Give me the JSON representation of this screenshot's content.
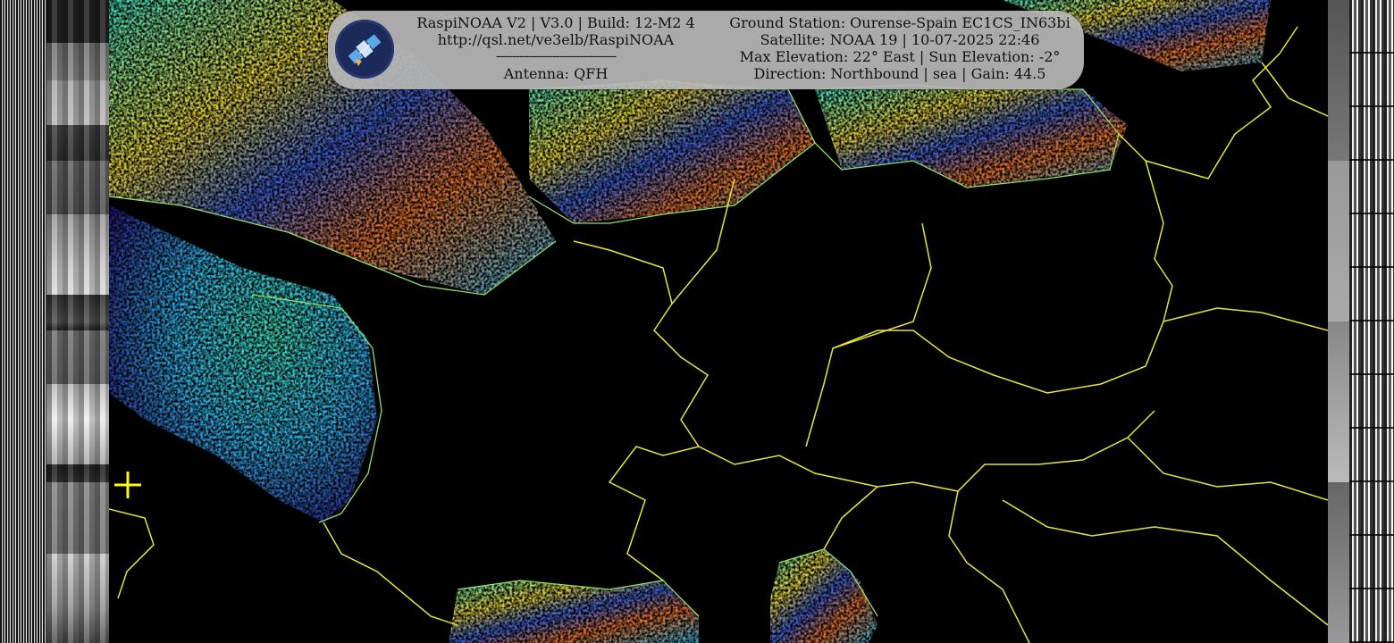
{
  "banner": {
    "software": "RaspiNOAA V2 | V3.0 | Build: 12-M2 4",
    "url": "http://qsl.net/ve3elb/RaspiNOAA",
    "separator": "------------------------------------",
    "antenna": "Antenna: QFH",
    "ground_station": "Ground Station: Ourense-Spain EC1CS_IN63bi",
    "satellite": "Satellite: NOAA 19 | 10-07-2025 22:46",
    "elevation": "Max Elevation: 22° East | Sun Elevation: -2°",
    "direction": "Direction: Northbound | sea | Gain: 44.5",
    "logo_icon": "satellite-icon"
  },
  "colors": {
    "border_lines": "#e6e63a",
    "coast_lines": "#8ee06a",
    "cloud_palette": [
      "#2a1a8a",
      "#3c5fd6",
      "#2fb3e8",
      "#3fe0c0",
      "#7fe04a",
      "#e8d43a",
      "#e8722a",
      "#c83a2a"
    ],
    "crosshair": "#ffff00",
    "banner_bg": "#b9b9b9"
  }
}
